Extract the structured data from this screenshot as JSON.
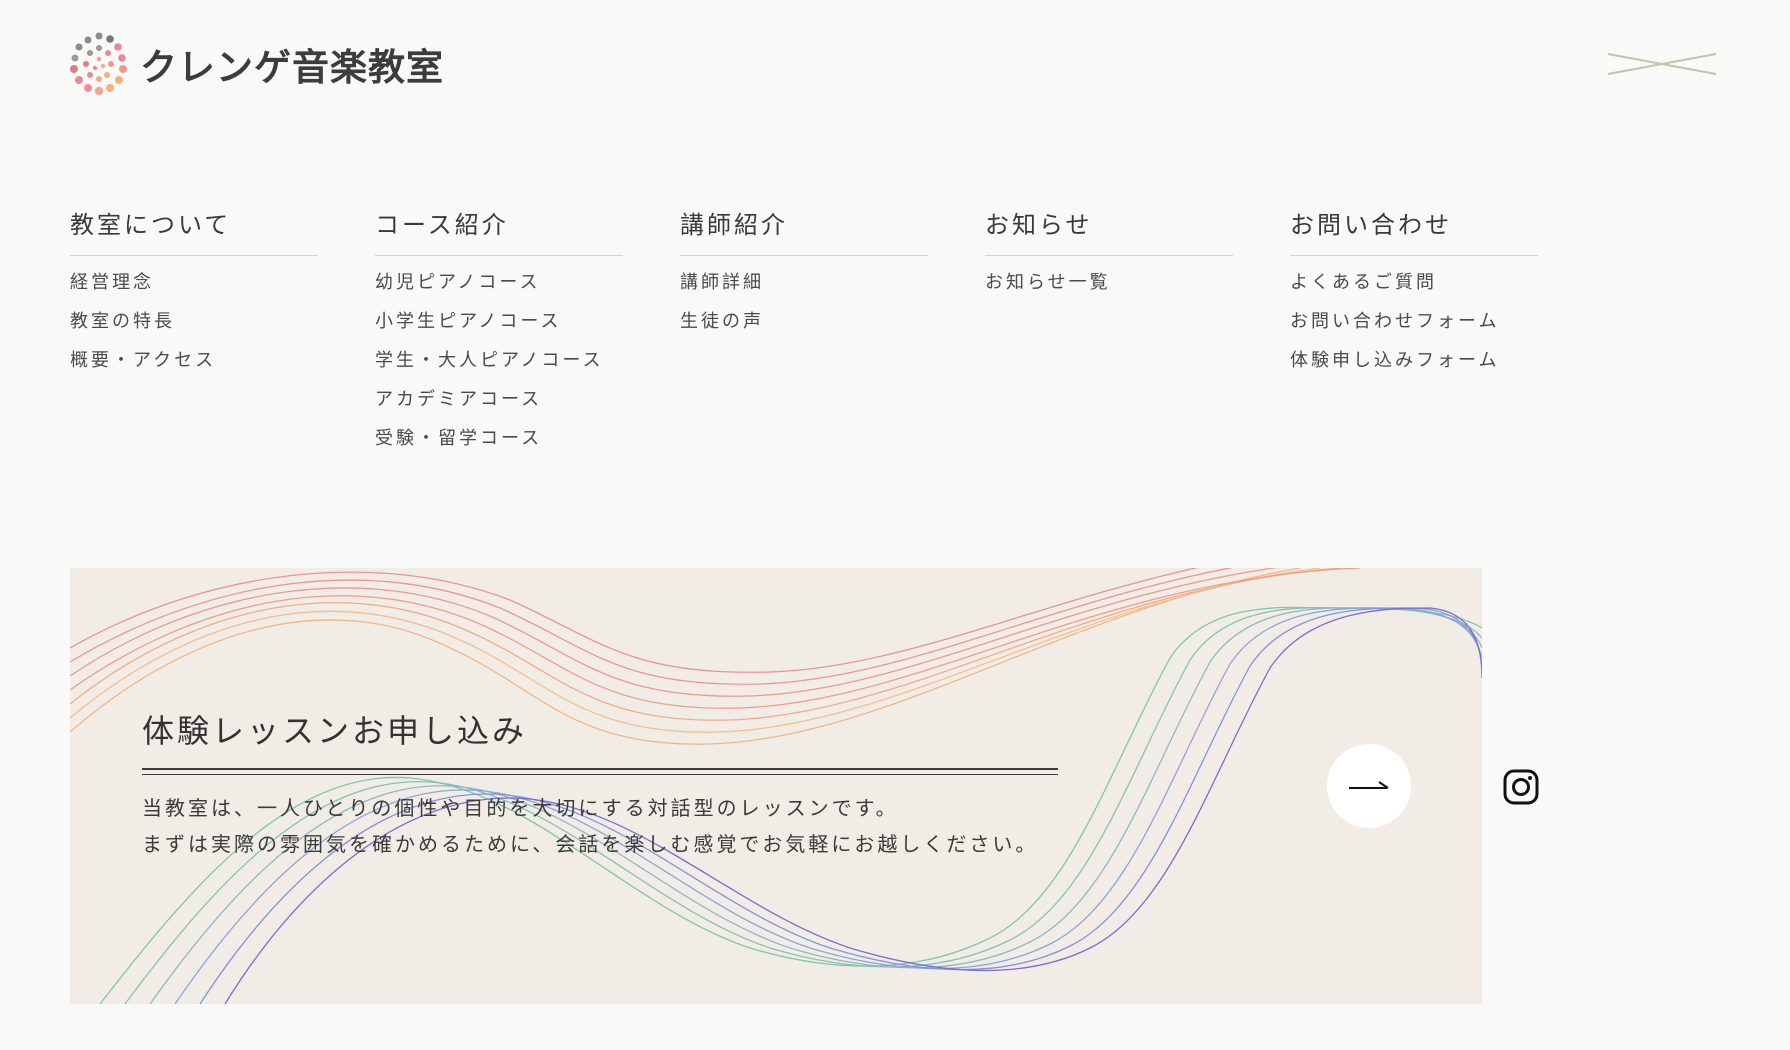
{
  "header": {
    "site_name": "クレンゲ音楽教室",
    "logo_icon": "dotted-circle-logo",
    "close_icon": "close-x-icon"
  },
  "nav": {
    "columns": [
      {
        "heading": "教室について",
        "items": [
          "経営理念",
          "教室の特長",
          "概要・アクセス"
        ]
      },
      {
        "heading": "コース紹介",
        "items": [
          "幼児ピアノコース",
          "小学生ピアノコース",
          "学生・大人ピアノコース",
          "アカデミアコース",
          "受験・留学コース"
        ]
      },
      {
        "heading": "講師紹介",
        "items": [
          "講師詳細",
          "生徒の声"
        ]
      },
      {
        "heading": "お知らせ",
        "items": [
          "お知らせ一覧"
        ]
      },
      {
        "heading": "お問い合わせ",
        "items": [
          "よくあるご質問",
          "お問い合わせフォーム",
          "体験申し込みフォーム"
        ]
      }
    ]
  },
  "banner": {
    "title": "体験レッスンお申し込み",
    "description": [
      "当教室は、一人ひとりの個性や目的を大切にする対話型のレッスンです。",
      "まずは実際の雰囲気を確かめるために、会話を楽しむ感覚でお気軽にお越しください。"
    ],
    "arrow_icon": "arrow-right-icon"
  },
  "social": {
    "icon": "instagram-icon"
  },
  "colors": {
    "background": "#f9f9f7",
    "banner_bg": "#f2ece6",
    "text": "#3a3a3a",
    "wave_orange": "#f2b785",
    "wave_pink": "#ec9e9c",
    "wave_green": "#7cc9a8",
    "wave_blue": "#8ba6d6",
    "wave_purple": "#7b6cd1"
  }
}
